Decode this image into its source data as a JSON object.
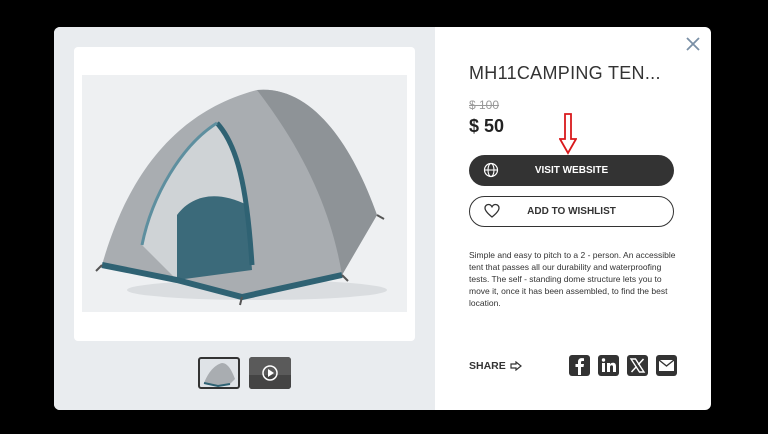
{
  "product": {
    "title": "MH11CAMPING TEN...",
    "old_price": "$ 100",
    "price": "$ 50",
    "description": "Simple and easy to pitch to a 2 - person. An accessible tent that passes all our durability and waterproofing tests. The self - standing dome structure lets you to move it, once it has been assembled, to find the best location."
  },
  "buttons": {
    "visit_label": "VISIT WEBSITE",
    "wishlist_label": "ADD TO WISHLIST"
  },
  "share": {
    "label": "SHARE",
    "networks": [
      "facebook-icon",
      "linkedin-icon",
      "x-icon",
      "email-icon"
    ]
  },
  "colors": {
    "primary": "#333333",
    "annotation_arrow": "#d9191c",
    "tent_grey": "#a9adb1",
    "tent_teal": "#3d6f80"
  }
}
